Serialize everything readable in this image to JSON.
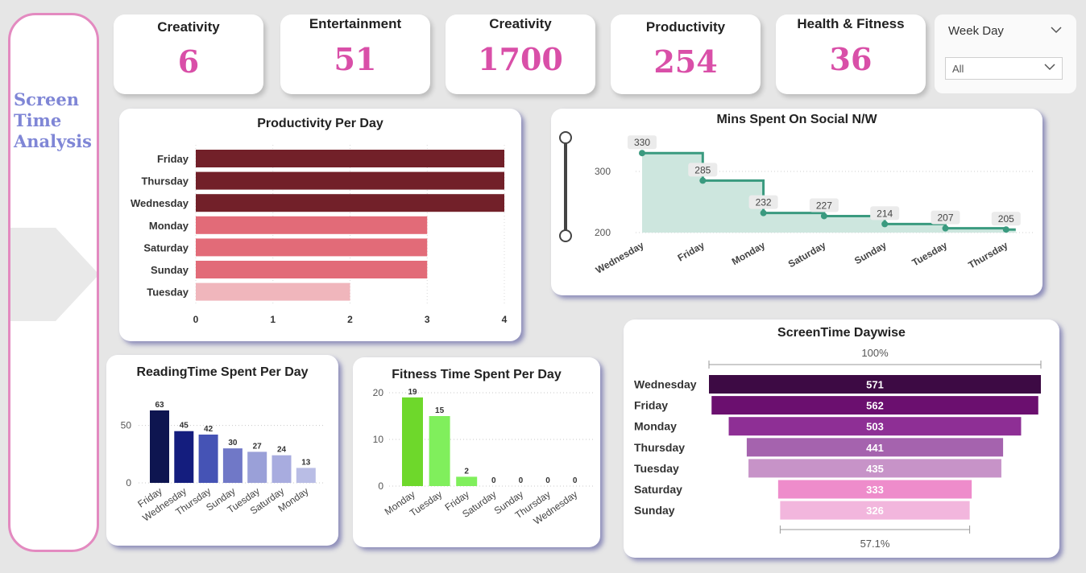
{
  "sidebar": {
    "title": "Screen\nTime\nAnalysis"
  },
  "kpis": [
    {
      "label": "Creativity",
      "value": "6"
    },
    {
      "label": "Entertainment",
      "value": "51"
    },
    {
      "label": "Creativity",
      "value": "1700"
    },
    {
      "label": "Productivity",
      "value": "254"
    },
    {
      "label": "Health & Fitness",
      "value": "36"
    }
  ],
  "filter": {
    "label": "Week Day",
    "selected": "All"
  },
  "colors": {
    "kpi_value": "#d94fa8",
    "sidebar_title": "#7f86d6",
    "social_line": "#3a9a7f"
  },
  "chart_data": [
    {
      "type": "bar",
      "orientation": "horizontal",
      "title": "Productivity Per Day",
      "categories": [
        "Friday",
        "Thursday",
        "Wednesday",
        "Monday",
        "Saturday",
        "Sunday",
        "Tuesday"
      ],
      "values": [
        4,
        4,
        4,
        3,
        3,
        3,
        2
      ],
      "xticks": [
        "0",
        "1",
        "2",
        "3",
        "4"
      ],
      "xlim": [
        0,
        4
      ],
      "colors": [
        "#722029",
        "#722029",
        "#722029",
        "#e26b78",
        "#e26b78",
        "#e26b78",
        "#f0b6bc"
      ]
    },
    {
      "type": "area",
      "title": "Mins Spent On Social N/W",
      "categories": [
        "Wednesday",
        "Friday",
        "Monday",
        "Saturday",
        "Sunday",
        "Tuesday",
        "Thursday"
      ],
      "values": [
        330,
        285,
        232,
        227,
        214,
        207,
        205
      ],
      "yticks": [
        "200",
        "300"
      ],
      "ylim": [
        200,
        330
      ]
    },
    {
      "type": "bar",
      "title": "ReadingTime Spent Per Day",
      "categories": [
        "Friday",
        "Wednesday",
        "Thursday",
        "Sunday",
        "Tuesday",
        "Saturday",
        "Monday"
      ],
      "values": [
        63,
        45,
        42,
        30,
        27,
        24,
        13
      ],
      "yticks": [
        "0",
        "50"
      ],
      "ylim": [
        0,
        63
      ],
      "colors": [
        "#0e1550",
        "#141d7e",
        "#4553b5",
        "#7078c7",
        "#9aa0d8",
        "#a8acdf",
        "#b9bde5"
      ]
    },
    {
      "type": "bar",
      "title": "Fitness Time Spent Per Day",
      "categories": [
        "Monday",
        "Tuesday",
        "Friday",
        "Saturday",
        "Sunday",
        "Thursday",
        "Wednesday"
      ],
      "values": [
        19,
        15,
        2,
        0,
        0,
        0,
        0
      ],
      "yticks": [
        "0",
        "10",
        "20"
      ],
      "ylim": [
        0,
        20
      ],
      "colors": [
        "#6ed82b",
        "#80ef5c",
        "#80ef5c",
        "#80ef5c",
        "#80ef5c",
        "#80ef5c",
        "#80ef5c"
      ]
    },
    {
      "type": "funnel",
      "title": "ScreenTime Daywise",
      "categories": [
        "Wednesday",
        "Friday",
        "Monday",
        "Thursday",
        "Tuesday",
        "Saturday",
        "Sunday"
      ],
      "values": [
        571,
        562,
        503,
        441,
        435,
        333,
        326
      ],
      "top_label": "100%",
      "bottom_label": "57.1%",
      "colors": [
        "#3d0a44",
        "#6b0f6f",
        "#8e2f95",
        "#a563ae",
        "#c793c8",
        "#ee8ccb",
        "#f2b6dd"
      ]
    }
  ]
}
